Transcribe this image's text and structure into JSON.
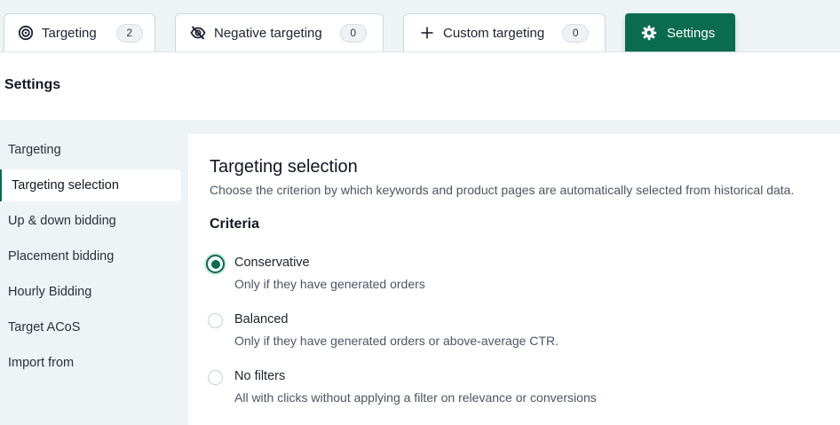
{
  "tabs": [
    {
      "label": "Targeting",
      "count": "2",
      "icon": "target-icon"
    },
    {
      "label": "Negative targeting",
      "count": "0",
      "icon": "eye-off-icon"
    },
    {
      "label": "Custom targeting",
      "count": "0",
      "icon": "plus-icon"
    },
    {
      "label": "Settings",
      "icon": "gear-icon",
      "active": true
    }
  ],
  "page": {
    "title": "Settings"
  },
  "sidebar": {
    "items": [
      {
        "label": "Targeting"
      },
      {
        "label": "Targeting selection",
        "active": true
      },
      {
        "label": "Up & down bidding"
      },
      {
        "label": "Placement bidding"
      },
      {
        "label": "Hourly Bidding"
      },
      {
        "label": "Target ACoS"
      },
      {
        "label": "Import from"
      }
    ]
  },
  "main": {
    "title": "Targeting selection",
    "description": "Choose the criterion by which keywords and product pages are automatically selected from historical data.",
    "criteria_heading": "Criteria",
    "options": [
      {
        "label": "Conservative",
        "description": "Only if they have generated orders",
        "selected": true
      },
      {
        "label": "Balanced",
        "description": "Only if they have generated orders or above-average CTR.",
        "selected": false
      },
      {
        "label": "No filters",
        "description": "All with clicks without applying a filter on relevance or conversions",
        "selected": false
      }
    ]
  },
  "colors": {
    "accent": "#0b6b4f",
    "background": "#eef3f6"
  }
}
